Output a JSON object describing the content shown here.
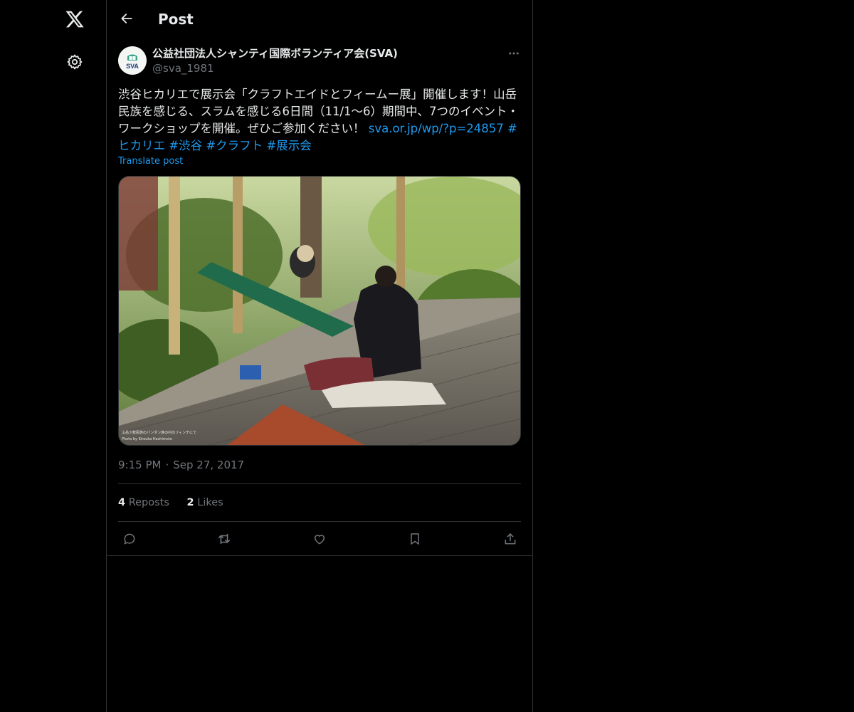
{
  "nav": {
    "logo_icon": "x-logo-icon",
    "settings_icon": "gear-icon"
  },
  "header": {
    "title": "Post",
    "back_icon": "arrow-left-icon"
  },
  "post": {
    "author": {
      "display_name": "公益社団法人シャンティ国際ボランティア会(SVA)",
      "handle": "@sva_1981",
      "avatar_text": "SVA"
    },
    "text_plain": "渋谷ヒカリエで展示会「クラフトエイドとフィームー展」開催します！山岳民族を感じる、スラムを感じる6日間（11/1〜6）期間中、7つのイベント・ワークショップを開催。ぜひご参加ください！ ",
    "link": "sva.or.jp/wp/?p=24857",
    "hashtags": [
      "#ヒカリエ",
      "#渋谷",
      "#クラフト",
      "#展示会"
    ],
    "translate_label": "Translate post",
    "media": {
      "caption_line1": "山岳少数民族のパンダン族の村のフィンチにて",
      "caption_line2": "Photo by Kirouka Hashimoto"
    },
    "time": "9:15 PM",
    "date": "Sep 27, 2017",
    "reposts_count": "4",
    "reposts_label": "Reposts",
    "likes_count": "2",
    "likes_label": "Likes"
  },
  "actions": [
    "reply-icon",
    "repost-icon",
    "like-icon",
    "bookmark-icon",
    "share-icon"
  ],
  "colors": {
    "background": "#000000",
    "text": "#e7e9ea",
    "muted": "#71767b",
    "link": "#1d9bf0",
    "border": "#2f3336"
  }
}
